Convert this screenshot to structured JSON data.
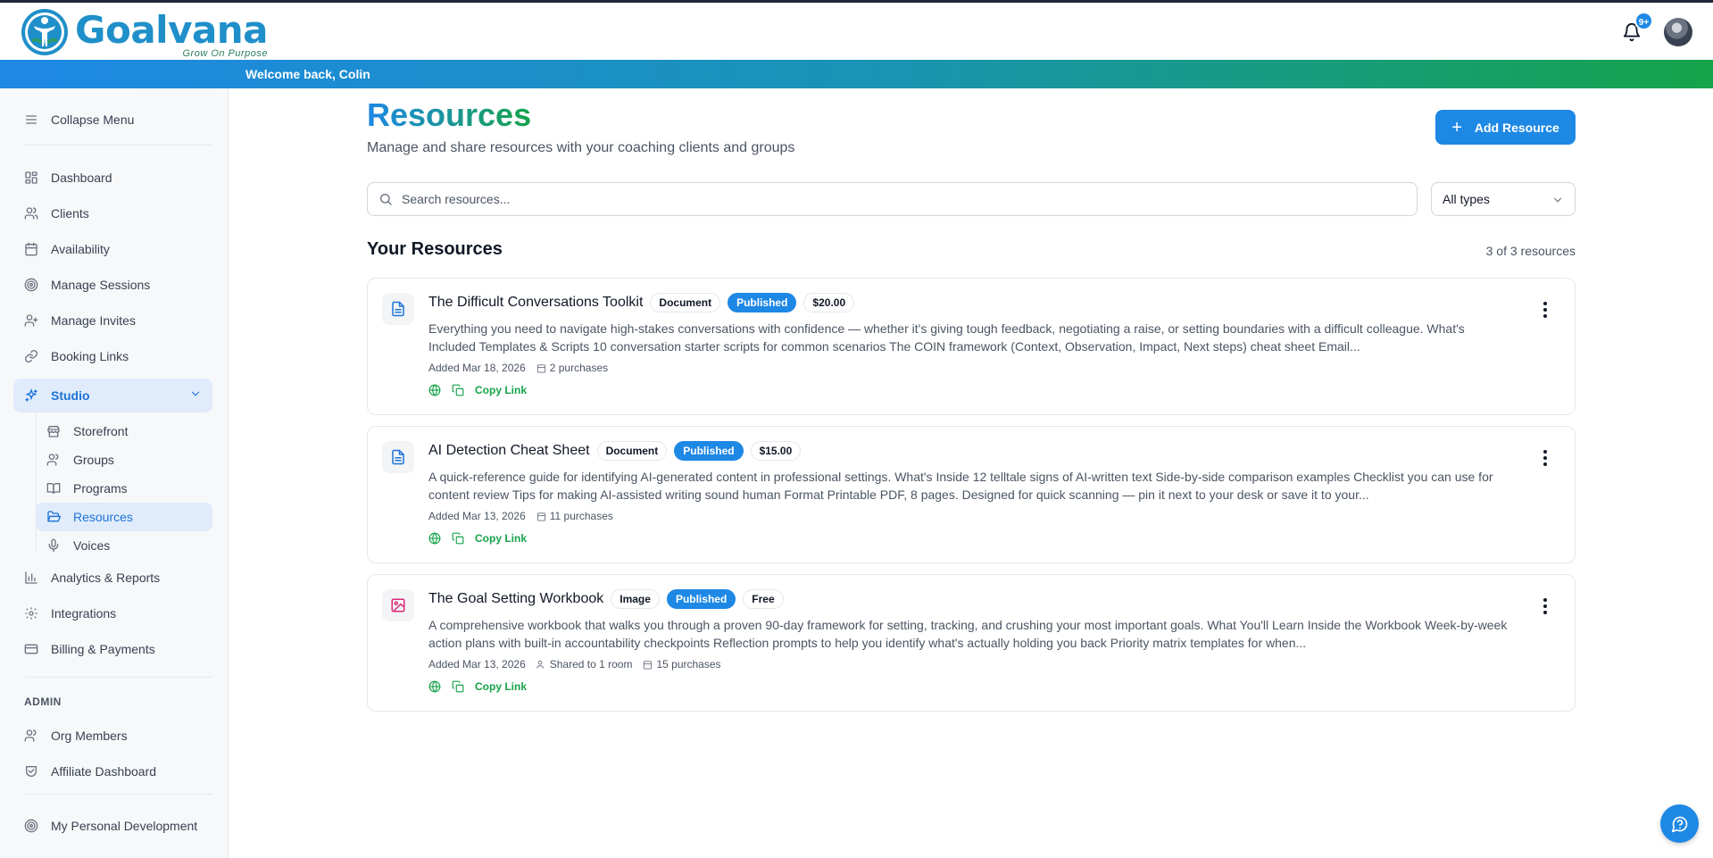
{
  "app": {
    "logo_word": "Goalvana",
    "logo_tagline": "Grow On Purpose",
    "notification_count": "9+",
    "welcome": "Welcome back, Colin"
  },
  "sidebar": {
    "collapse": "Collapse Menu",
    "items": {
      "dashboard": "Dashboard",
      "clients": "Clients",
      "availability": "Availability",
      "manage_sessions": "Manage Sessions",
      "manage_invites": "Manage Invites",
      "booking_links": "Booking Links",
      "studio": "Studio",
      "storefront": "Storefront",
      "groups": "Groups",
      "programs": "Programs",
      "resources": "Resources",
      "voices": "Voices",
      "analytics": "Analytics & Reports",
      "integrations": "Integrations",
      "billing": "Billing & Payments"
    },
    "admin_label": "ADMIN",
    "admin_items": {
      "org_members": "Org Members",
      "affiliate": "Affiliate Dashboard"
    },
    "personal": "My Personal Development"
  },
  "page": {
    "title": "Resources",
    "subtitle": "Manage and share resources with your coaching clients and groups",
    "add_button": "Add Resource",
    "search_placeholder": "Search resources...",
    "type_filter": "All types",
    "section_title": "Your Resources",
    "count": "3 of 3 resources",
    "copy_link": "Copy Link"
  },
  "resources": [
    {
      "title": "The Difficult Conversations Toolkit",
      "type": "Document",
      "status": "Published",
      "price": "$20.00",
      "description": "Everything you need to navigate high-stakes conversations with confidence — whether it's giving tough feedback, negotiating a raise, or setting boundaries with a difficult colleague. What's Included Templates & Scripts 10 conversation starter scripts for common scenarios The COIN framework (Context, Observation, Impact, Next steps) cheat sheet Email...",
      "added": "Added Mar 18, 2026",
      "purchases": "2 purchases",
      "icon": "document-icon"
    },
    {
      "title": "AI Detection Cheat Sheet",
      "type": "Document",
      "status": "Published",
      "price": "$15.00",
      "description": "A quick-reference guide for identifying AI-generated content in professional settings. What's Inside 12 telltale signs of AI-written text Side-by-side comparison examples Checklist you can use for content review Tips for making AI-assisted writing sound human Format Printable PDF, 8 pages. Designed for quick scanning — pin it next to your desk or save it to your...",
      "added": "Added Mar 13, 2026",
      "purchases": "11 purchases",
      "icon": "document-icon"
    },
    {
      "title": "The Goal Setting Workbook",
      "type": "Image",
      "status": "Published",
      "price": "Free",
      "description": "A comprehensive workbook that walks you through a proven 90-day framework for setting, tracking, and crushing your most important goals. What You'll Learn Inside the Workbook Week-by-week action plans with built-in accountability checkpoints Reflection prompts to help you identify what's actually holding you back Priority matrix templates for when...",
      "added": "Added Mar 13, 2026",
      "shared": "Shared to 1 room",
      "purchases": "15 purchases",
      "icon": "image-icon"
    }
  ],
  "colors": {
    "primary": "#1e88e5",
    "green": "#16a34a",
    "gradient_start": "#1e88e5",
    "gradient_end": "#16a34a"
  }
}
